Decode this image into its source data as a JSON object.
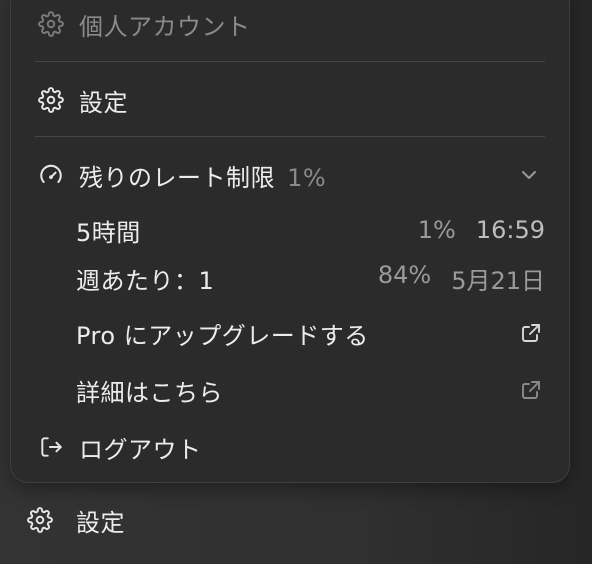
{
  "menu": {
    "account": {
      "label": "個人アカウント",
      "icon": "gear-icon"
    },
    "settings": {
      "label": "設定",
      "icon": "gear-icon"
    },
    "rate_limit": {
      "label": "残りのレート制限",
      "percent": "1%",
      "icon": "gauge-icon",
      "rows": [
        {
          "label": "5時間",
          "percent": "1%",
          "reset": "16:59"
        },
        {
          "label": "週あたり：1",
          "percent": "84%",
          "reset": "5月21日"
        }
      ]
    },
    "upgrade": {
      "label": "Pro にアップグレードする",
      "icon": "external-link-icon"
    },
    "learn_more": {
      "label": "詳細はこちら",
      "icon": "external-link-icon"
    },
    "logout": {
      "label": "ログアウト",
      "icon": "logout-icon"
    }
  },
  "footer": {
    "settings": {
      "label": "設定",
      "icon": "gear-icon"
    }
  }
}
